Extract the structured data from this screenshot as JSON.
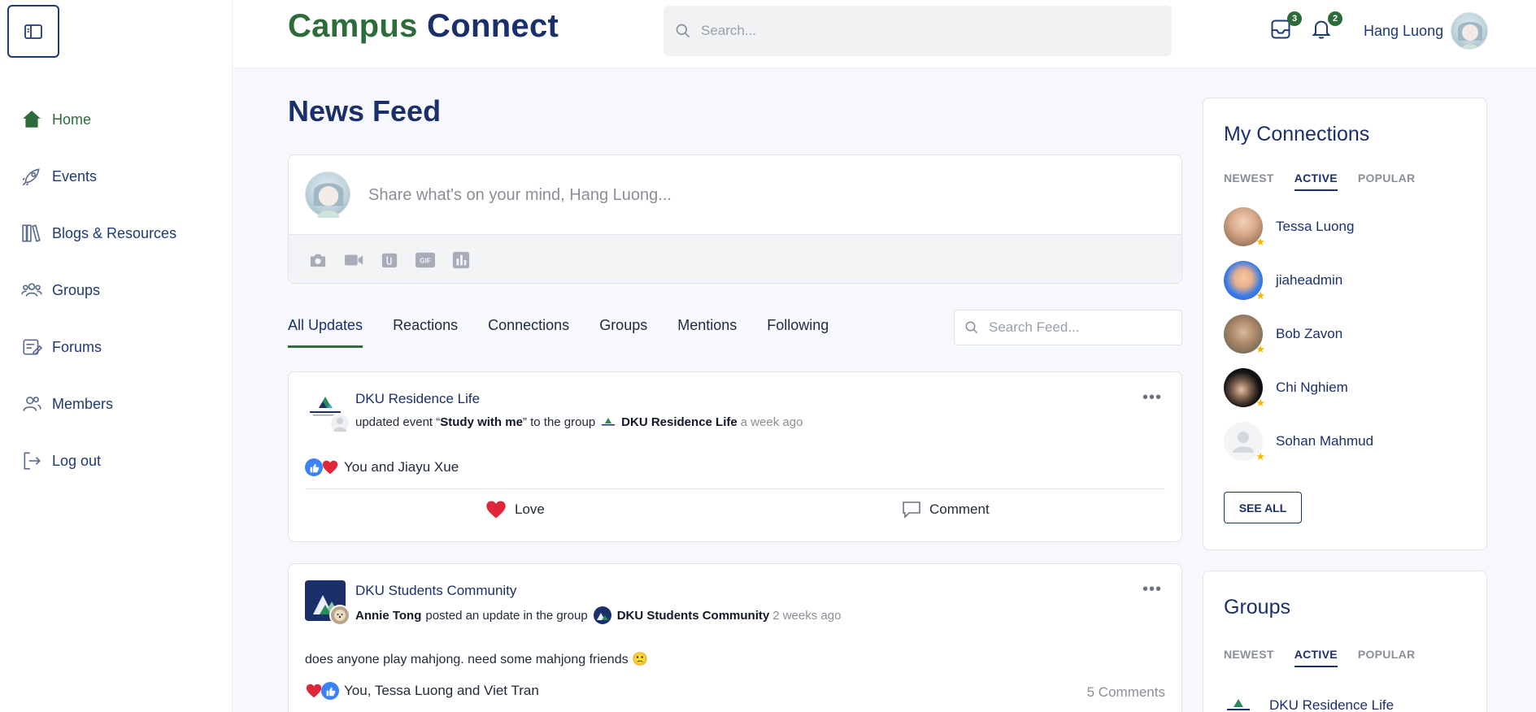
{
  "brand": {
    "part1": "Campus",
    "part2": "Connect"
  },
  "header": {
    "search_placeholder": "Search...",
    "inbox_count": "3",
    "notifications_count": "2",
    "user_name": "Hang Luong"
  },
  "sidebar": {
    "items": [
      {
        "label": "Home",
        "icon": "home-icon"
      },
      {
        "label": "Events",
        "icon": "rocket-icon"
      },
      {
        "label": "Blogs & Resources",
        "icon": "books-icon"
      },
      {
        "label": "Groups",
        "icon": "users-icon"
      },
      {
        "label": "Forums",
        "icon": "forum-icon"
      },
      {
        "label": "Members",
        "icon": "members-icon"
      },
      {
        "label": "Log out",
        "icon": "logout-icon"
      }
    ]
  },
  "main": {
    "title": "News Feed",
    "composer_placeholder": "Share what's on your mind, Hang Luong...",
    "tabs": [
      "All Updates",
      "Reactions",
      "Connections",
      "Groups",
      "Mentions",
      "Following"
    ],
    "feed_search_placeholder": "Search Feed..."
  },
  "posts": [
    {
      "group": "DKU Residence Life",
      "meta_action": "updated event “",
      "meta_event": "Study with me",
      "meta_mid": "” to the group",
      "meta_group": "DKU Residence Life",
      "time": "a week ago",
      "reactions_text": "You and Jiayu Xue",
      "love_label": "Love",
      "comment_label": "Comment"
    },
    {
      "group": "DKU Students Community",
      "meta_user": "Annie Tong",
      "meta_mid": "posted an update in the group",
      "meta_group": "DKU Students Community",
      "time": "2 weeks ago",
      "body": "does anyone play mahjong. need some mahjong friends 🙁",
      "reactions_text": "You, Tessa Luong and Viet Tran",
      "comments_count": "5 Comments"
    }
  ],
  "connections": {
    "title": "My Connections",
    "tabs": [
      "NEWEST",
      "ACTIVE",
      "POPULAR"
    ],
    "people": [
      "Tessa Luong",
      "jiaheadmin",
      "Bob Zavon",
      "Chi Nghiem",
      "Sohan Mahmud"
    ],
    "see_all": "SEE ALL"
  },
  "groups_panel": {
    "title": "Groups",
    "tabs": [
      "NEWEST",
      "ACTIVE",
      "POPULAR"
    ],
    "first_group": "DKU Residence Life"
  },
  "colors": {
    "brand_green": "#2e6b3a",
    "brand_navy": "#1b2f6b",
    "love_red": "#e0263a",
    "like_blue": "#3b82f6"
  }
}
